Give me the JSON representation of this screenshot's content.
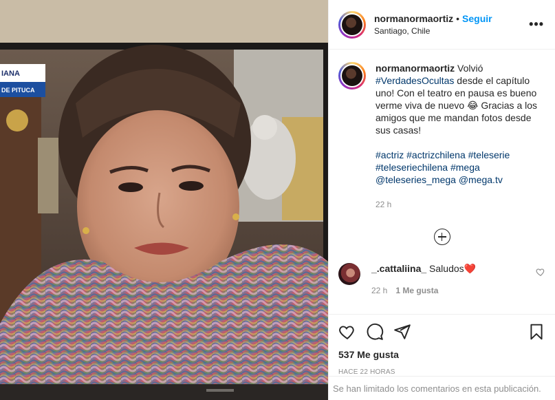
{
  "post": {
    "username": "normanormaortiz",
    "separator": "•",
    "follow_label": "Seguir",
    "location": "Santiago, Chile",
    "more_label": "•••"
  },
  "caption": {
    "username": "normanormaortiz",
    "text_before": "Volvió",
    "hashtag_main": "#VerdadesOcultas",
    "text_after": "desde el capítulo uno! Con el teatro en pausa es bueno verme viva de nuevo 😂 Gracias a los amigos que me mandan fotos desde sus casas!",
    "tags": [
      "#actriz",
      "#actrizchilena",
      "#teleserie",
      "#teleseriechilena",
      "#mega",
      "@teleseries_mega",
      "@mega.tv"
    ],
    "time": "22 h"
  },
  "comments": [
    {
      "username": "_.cattaliina_",
      "text": "Saludos",
      "emoji": "❤️",
      "time": "22 h",
      "likes": "1 Me gusta"
    }
  ],
  "actions": {
    "likes_count": "537 Me gusta",
    "posted_ago": "HACE 22 HORAS"
  },
  "footer": {
    "notice": "Se han limitado los comentarios en esta publicación."
  },
  "photo": {
    "tv_label_top": "IANA",
    "tv_label_bottom": "DE PITUCA"
  },
  "colors": {
    "link": "#00376b",
    "follow": "#0095f6",
    "muted": "#8e8e8e"
  }
}
